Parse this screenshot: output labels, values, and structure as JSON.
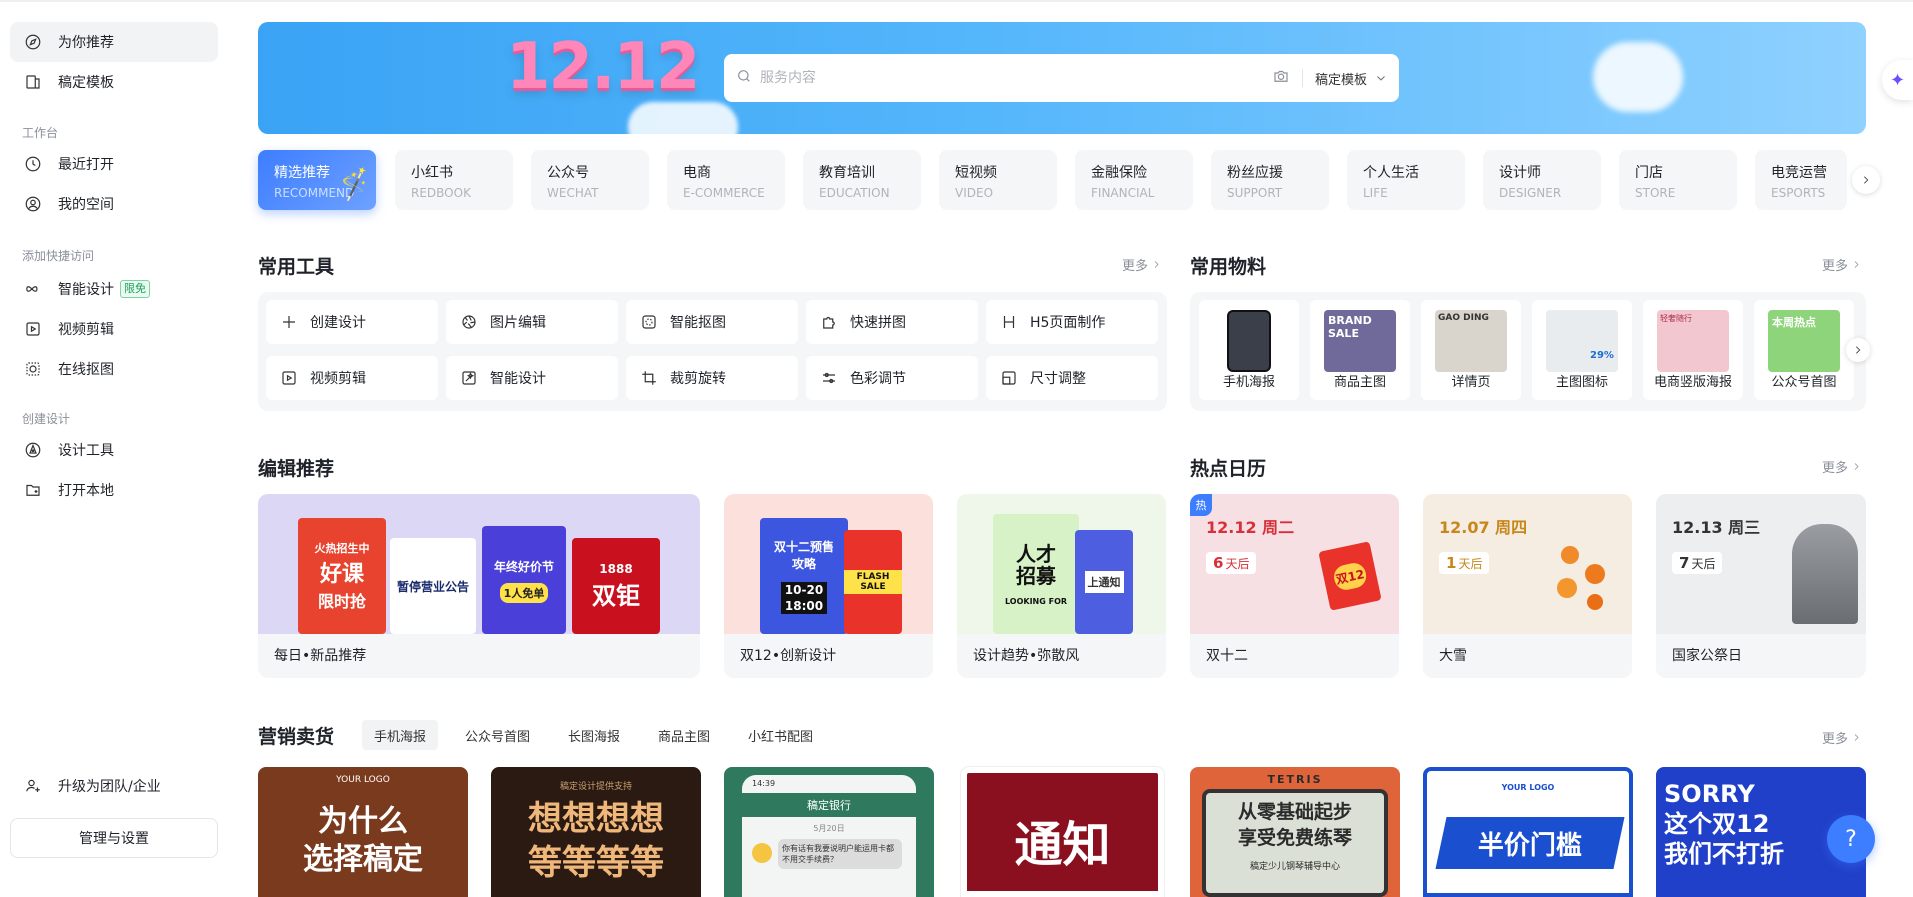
{
  "sidebar": {
    "items": [
      {
        "label": "为你推荐",
        "icon": "compass-icon"
      },
      {
        "label": "稿定模板",
        "icon": "template-icon"
      }
    ],
    "workspace_title": "工作台",
    "workspace": [
      {
        "label": "最近打开",
        "icon": "clock-icon"
      },
      {
        "label": "我的空间",
        "icon": "user-circle-icon"
      }
    ],
    "quick_title": "添加快捷访问",
    "quick": [
      {
        "label": "智能设计",
        "icon": "infinity-icon",
        "badge": "限免"
      },
      {
        "label": "视频剪辑",
        "icon": "video-icon"
      },
      {
        "label": "在线抠图",
        "icon": "cutout-icon"
      }
    ],
    "create_title": "创建设计",
    "create": [
      {
        "label": "设计工具",
        "icon": "pen-tool-icon"
      },
      {
        "label": "打开本地",
        "icon": "folder-plus-icon"
      }
    ],
    "upgrade": "升级为团队/企业",
    "manage": "管理与设置"
  },
  "banner": {
    "art_text": "12.12",
    "search_placeholder": "服务内容",
    "scope": "稿定模板"
  },
  "categories": [
    {
      "cn": "精选推荐",
      "en": "RECOMMEND"
    },
    {
      "cn": "小红书",
      "en": "REDBOOK"
    },
    {
      "cn": "公众号",
      "en": "WECHAT"
    },
    {
      "cn": "电商",
      "en": "E-COMMERCE"
    },
    {
      "cn": "教育培训",
      "en": "EDUCATION"
    },
    {
      "cn": "短视频",
      "en": "VIDEO"
    },
    {
      "cn": "金融保险",
      "en": "FINANCIAL"
    },
    {
      "cn": "粉丝应援",
      "en": "SUPPORT"
    },
    {
      "cn": "个人生活",
      "en": "LIFE"
    },
    {
      "cn": "设计师",
      "en": "DESIGNER"
    },
    {
      "cn": "门店",
      "en": "STORE"
    },
    {
      "cn": "电竞运营",
      "en": "ESPORTS"
    }
  ],
  "tools": {
    "title": "常用工具",
    "more": "更多",
    "items": [
      {
        "label": "创建设计",
        "icon": "plus-icon"
      },
      {
        "label": "图片编辑",
        "icon": "aperture-icon"
      },
      {
        "label": "智能抠图",
        "icon": "cutout-icon"
      },
      {
        "label": "快速拼图",
        "icon": "puzzle-icon"
      },
      {
        "label": "H5页面制作",
        "icon": "h5-icon"
      },
      {
        "label": "视频剪辑",
        "icon": "video-icon"
      },
      {
        "label": "智能设计",
        "icon": "magic-image-icon"
      },
      {
        "label": "裁剪旋转",
        "icon": "crop-icon"
      },
      {
        "label": "色彩调节",
        "icon": "sliders-icon"
      },
      {
        "label": "尺寸调整",
        "icon": "resize-icon"
      }
    ]
  },
  "materials": {
    "title": "常用物料",
    "more": "更多",
    "items": [
      {
        "label": "手机海报",
        "color": "#3a3f4a"
      },
      {
        "label": "商品主图",
        "color": "#6f6a9a",
        "art": "BRAND SALE"
      },
      {
        "label": "详情页",
        "color": "#d9d4cc",
        "art": "GAO DING"
      },
      {
        "label": "主图图标",
        "color": "#e9ecef",
        "art": "29%"
      },
      {
        "label": "电商竖版海报",
        "color": "#f3c7cf",
        "art": "轻奢随行"
      },
      {
        "label": "公众号首图",
        "color": "#8ed47a",
        "art": "本周热点"
      }
    ]
  },
  "editorial": {
    "title": "编辑推荐",
    "items": [
      {
        "caption": "每日•新品推荐",
        "art": [
          "火热招生中",
          "好课",
          "限时抢",
          "暂停营业公告",
          "年终好价节",
          "1人免单",
          "1888",
          "双钜"
        ]
      },
      {
        "caption": "双12•创新设计",
        "art": [
          "双十二预售攻略",
          "FLASH SALE",
          "10-20",
          "18:00"
        ]
      },
      {
        "caption": "设计趋势•弥散风",
        "art": [
          "人才招募",
          "LOOKING FOR",
          "上通知"
        ]
      }
    ]
  },
  "calendar": {
    "title": "热点日历",
    "more": "更多",
    "items": [
      {
        "date": "12.12 周二",
        "days": "6",
        "unit": "天后",
        "caption": "双十二",
        "hot": "热",
        "art": "双12",
        "color": "#f7e0e3",
        "accent": "#d6303a"
      },
      {
        "date": "12.07 周四",
        "days": "1",
        "unit": "天后",
        "caption": "大雪",
        "hot": "",
        "color": "#f5ece2",
        "accent": "#c8871a"
      },
      {
        "date": "12.13 周三",
        "days": "7",
        "unit": "天后",
        "caption": "国家公祭日",
        "hot": "",
        "color": "#eceef0",
        "accent": "#333333"
      }
    ]
  },
  "marketing": {
    "title": "营销卖货",
    "more": "更多",
    "tabs": [
      "手机海报",
      "公众号首图",
      "长图海报",
      "商品主图",
      "小红书配图"
    ],
    "cards": [
      {
        "text": "为什么\n选择稿定",
        "top_text": "YOUR LOGO",
        "bg": "#7a3a1e",
        "fg": "#ffffff"
      },
      {
        "text": "想想想想\n等等等等",
        "top_text": "稿定设计提供支持",
        "bg": "#2b1a12",
        "fg": "#f0b77a"
      },
      {
        "text": "稿定银行",
        "top_text": "14:39",
        "date": "5月20日",
        "msg": "你有话有我要说明户能运用卡都不用交手续费？",
        "bg": "#2f7a5e",
        "fg": "#ffffff"
      },
      {
        "text": "通知",
        "bg": "#8a1020",
        "fg": "#ffffff"
      },
      {
        "text": "从零基础起步\n享受免费练琴",
        "top_text": "TETRIS",
        "sub": "稿定少儿钢琴辅导中心",
        "bg": "#e0643a",
        "fg": "#2b2b2b"
      },
      {
        "text": "半价门槛",
        "top_text": "YOUR LOGO",
        "bg": "#ffffff",
        "fg": "#1a4fd0"
      },
      {
        "text": "SORRY\n这个双12\n我们不打折",
        "bg": "#2140c9",
        "fg": "#ffffff"
      }
    ]
  },
  "help": "?"
}
